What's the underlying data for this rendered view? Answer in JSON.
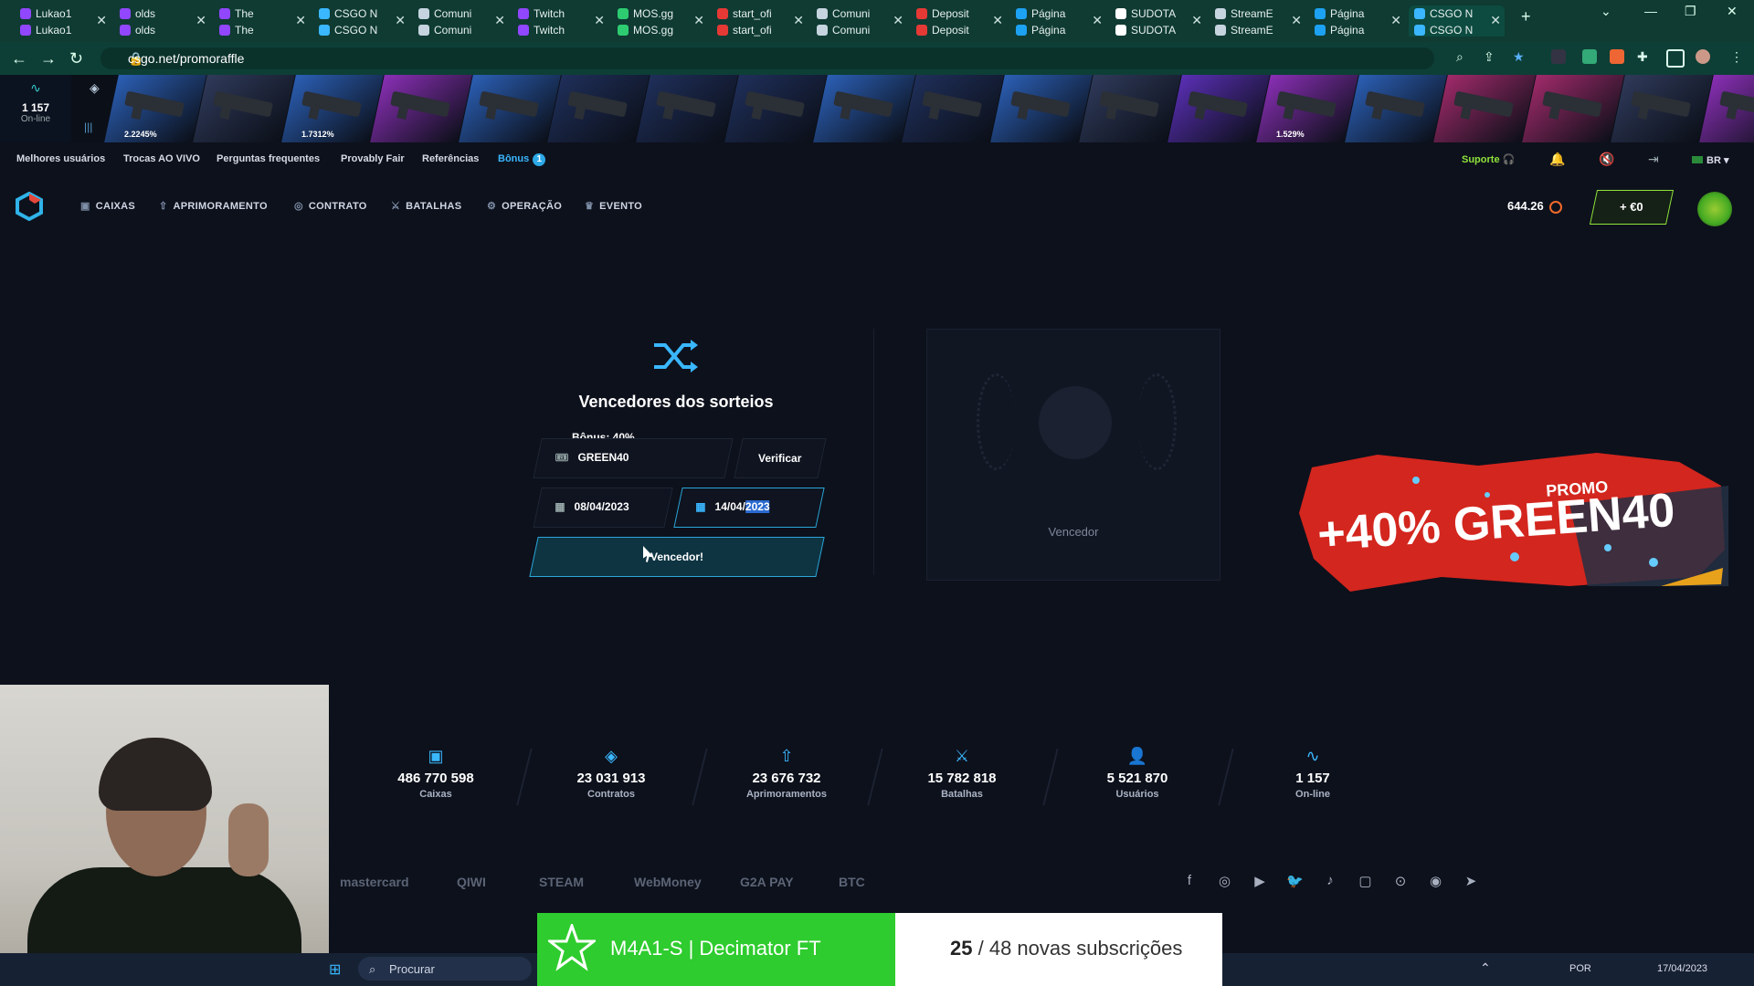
{
  "browser": {
    "tabs": [
      {
        "top": "Lukao1",
        "bottom": "Lukao1",
        "color": "#9146ff"
      },
      {
        "top": "olds",
        "bottom": "olds",
        "color": "#9146ff"
      },
      {
        "top": "The",
        "bottom": "The",
        "color": "#9146ff"
      },
      {
        "top": "CSGO N",
        "bottom": "CSGO N",
        "color": "#3ab7ff"
      },
      {
        "top": "Comuni",
        "bottom": "Comuni",
        "color": "#c6d4df"
      },
      {
        "top": "Twitch",
        "bottom": "Twitch",
        "color": "#9146ff"
      },
      {
        "top": "MOS.gg",
        "bottom": "MOS.gg",
        "color": "#2ecc71"
      },
      {
        "top": "start_ofi",
        "bottom": "start_ofi",
        "color": "#e53935"
      },
      {
        "top": "Comuni",
        "bottom": "Comuni",
        "color": "#c6d4df"
      },
      {
        "top": "Deposit",
        "bottom": "Deposit",
        "color": "#e53935"
      },
      {
        "top": "Página",
        "bottom": "Página",
        "color": "#1da1f2"
      },
      {
        "top": "SUDOTA",
        "bottom": "SUDOTA",
        "color": "#ffffff"
      },
      {
        "top": "StreamE",
        "bottom": "StreamE",
        "color": "#c6d4df"
      },
      {
        "top": "Página",
        "bottom": "Página",
        "color": "#1da1f2"
      },
      {
        "top": "CSGO N",
        "bottom": "CSGO N",
        "color": "#3ab7ff"
      }
    ],
    "url": "csgo.net/promoraffle"
  },
  "live": {
    "online_count": "1 157",
    "online_label": "On-line",
    "drops": [
      {
        "color": "#2b5fb5",
        "pct": "2.2245%"
      },
      {
        "color": "#2f3a5a",
        "pct": ""
      },
      {
        "color": "#2b5fb5",
        "pct": "1.7312%"
      },
      {
        "color": "#8a2fb5",
        "pct": ""
      },
      {
        "color": "#2b5fb5",
        "pct": ""
      },
      {
        "color": "#1f2f5a",
        "pct": ""
      },
      {
        "color": "#1f2f5a",
        "pct": ""
      },
      {
        "color": "#1f2f5a",
        "pct": ""
      },
      {
        "color": "#2b5fb5",
        "pct": ""
      },
      {
        "color": "#1f2f5a",
        "pct": ""
      },
      {
        "color": "#2b5fb5",
        "pct": ""
      },
      {
        "color": "#2f3a5a",
        "pct": ""
      },
      {
        "color": "#5a2fb5",
        "pct": ""
      },
      {
        "color": "#8a2fb5",
        "pct": "1.529%"
      },
      {
        "color": "#2b5fb5",
        "pct": ""
      },
      {
        "color": "#a02a6a",
        "pct": ""
      },
      {
        "color": "#a02a6a",
        "pct": ""
      },
      {
        "color": "#2f3a5a",
        "pct": ""
      },
      {
        "color": "#8a2fb5",
        "pct": ""
      }
    ]
  },
  "topmenu": {
    "items": [
      "Melhores usuários",
      "Trocas AO VIVO",
      "Perguntas frequentes",
      "Provably Fair",
      "Referências"
    ],
    "bonus": "Bônus",
    "bonus_count": "1",
    "support": "Suporte",
    "lang": "BR"
  },
  "mainnav": {
    "items": [
      {
        "icon": "▣",
        "label": "CAIXAS"
      },
      {
        "icon": "⇧",
        "label": "APRIMORAMENTO"
      },
      {
        "icon": "◎",
        "label": "CONTRATO"
      },
      {
        "icon": "⚔",
        "label": "BATALHAS"
      },
      {
        "icon": "⚙",
        "label": "OPERAÇÃO"
      },
      {
        "icon": "♛",
        "label": "EVENTO"
      }
    ],
    "balance": "644.26",
    "deposit": "+ €0"
  },
  "raffle": {
    "title": "Vencedores dos sorteios",
    "bonus_label": "Bônus: 40%",
    "code": "GREEN40",
    "verify": "Verificar",
    "date_from": "08/04/2023",
    "date_to_prefix": "14/04/",
    "date_to_selected": "2023",
    "winner_button": "Vencedor!",
    "winner_label": "Vencedor"
  },
  "promo": {
    "text": "+40% GREEN40",
    "tag": "PROMO"
  },
  "stats": [
    {
      "icon": "▣",
      "value": "486 770 598",
      "label": "Caixas"
    },
    {
      "icon": "◈",
      "value": "23 031 913",
      "label": "Contratos"
    },
    {
      "icon": "⇧",
      "value": "23 676 732",
      "label": "Aprimoramentos"
    },
    {
      "icon": "⚔",
      "value": "15 782 818",
      "label": "Batalhas"
    },
    {
      "icon": "👤",
      "value": "5 521 870",
      "label": "Usuários"
    },
    {
      "icon": "∿",
      "value": "1 157",
      "label": "On-line"
    }
  ],
  "payments": [
    "mastercard",
    "QIWI",
    "STEAM",
    "WebMoney",
    "G2A PAY",
    "BTC"
  ],
  "social": [
    "f",
    "◎",
    "▶",
    "🐦",
    "♪",
    "▢",
    "⊙",
    "◉",
    "➤"
  ],
  "taskbar": {
    "search": "Procurar",
    "lang": "POR",
    "date": "17/04/2023"
  },
  "overlay": {
    "item": "M4A1-S | Decimator FT",
    "count": "25",
    "text": "/ 48 novas subscrições"
  }
}
